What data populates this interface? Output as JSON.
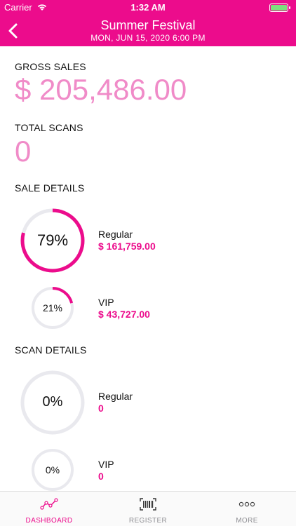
{
  "status_bar": {
    "carrier": "Carrier",
    "time": "1:32 AM"
  },
  "header": {
    "title": "Summer Festival",
    "subtitle": "MON, JUN 15, 2020 6:00 PM"
  },
  "gross_sales": {
    "label": "GROSS SALES",
    "value": "$ 205,486.00"
  },
  "total_scans": {
    "label": "TOTAL SCANS",
    "value": "0"
  },
  "sale_details": {
    "label": "SALE DETAILS",
    "items": [
      {
        "name": "Regular",
        "amount": "$ 161,759.00",
        "percent_label": "79%",
        "fraction": 0.79
      },
      {
        "name": "VIP",
        "amount": "$ 43,727.00",
        "percent_label": "21%",
        "fraction": 0.21
      }
    ]
  },
  "scan_details": {
    "label": "SCAN DETAILS",
    "items": [
      {
        "name": "Regular",
        "count": "0",
        "percent_label": "0%",
        "fraction": 0
      },
      {
        "name": "VIP",
        "count": "0",
        "percent_label": "0%",
        "fraction": 0
      }
    ]
  },
  "tabs": [
    {
      "label": "DASHBOARD",
      "icon": "line-chart-icon",
      "active": true
    },
    {
      "label": "REGISTER",
      "icon": "barcode-scan-icon",
      "active": false
    },
    {
      "label": "MORE",
      "icon": "more-dots-icon",
      "active": false
    }
  ],
  "colors": {
    "accent": "#ec0c8c",
    "accent_light": "#f08bc8",
    "track": "#e9e9ee",
    "inactive": "#8e8e93"
  }
}
